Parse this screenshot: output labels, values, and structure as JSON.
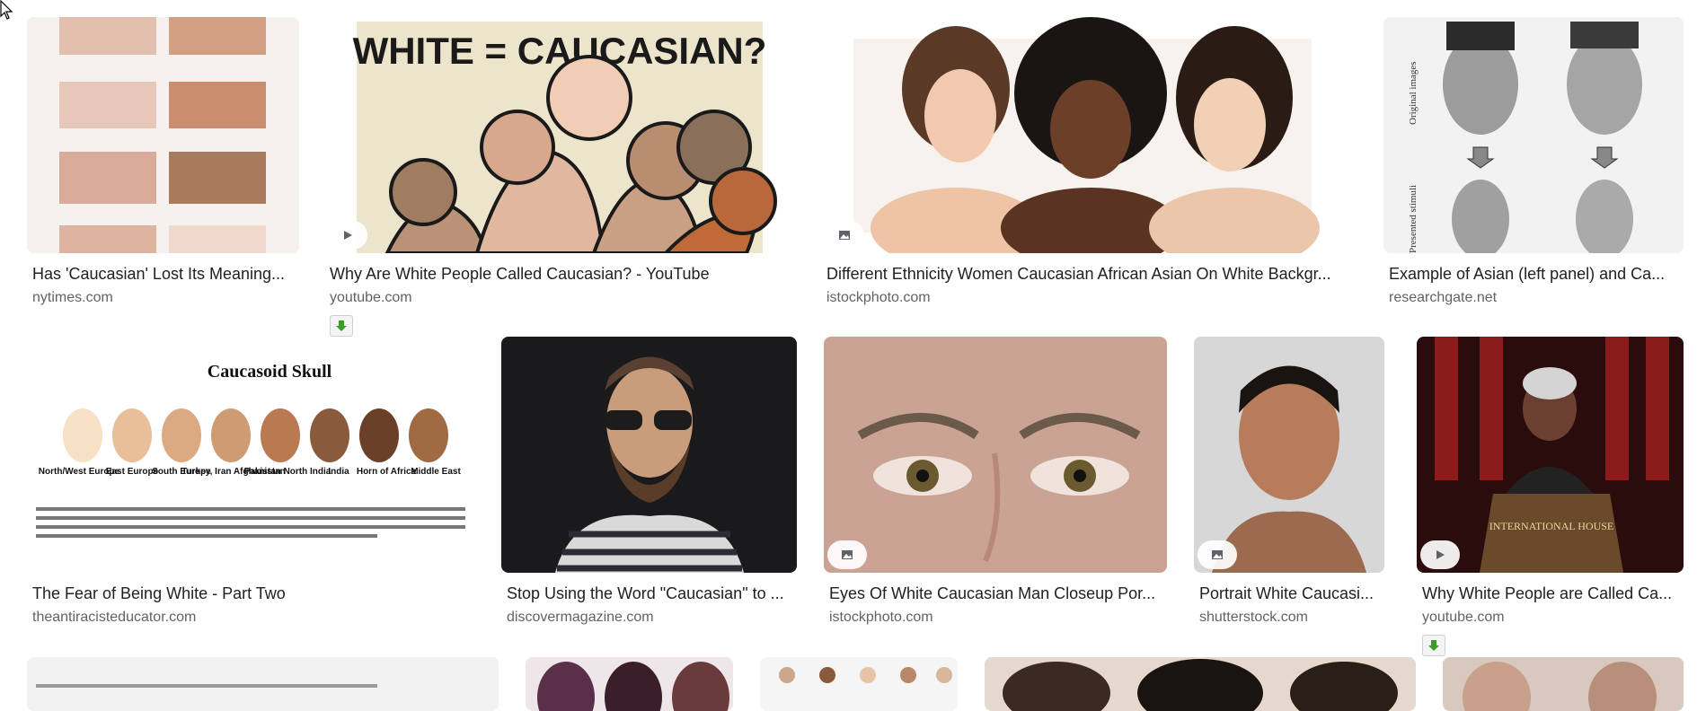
{
  "results": [
    {
      "title": "Has 'Caucasian' Lost Its Meaning...",
      "source": "nytimes.com",
      "badge": "none",
      "download": false
    },
    {
      "title": "Why Are White People Called Caucasian? - YouTube",
      "source": "youtube.com",
      "badge": "video",
      "download": true,
      "thumb_text": "WHITE = CAUCASIAN?"
    },
    {
      "title": "Different Ethnicity Women Caucasian African Asian On White Backgr...",
      "source": "istockphoto.com",
      "badge": "image",
      "download": false
    },
    {
      "title": "Example of Asian (left panel) and Ca...",
      "source": "researchgate.net",
      "badge": "none",
      "download": false,
      "thumb_labels": [
        "Original images",
        "Presented stimuli"
      ]
    },
    {
      "title": "The Fear of Being White - Part Two",
      "source": "theantiracisteducator.com",
      "badge": "none",
      "download": false,
      "thumb_text": "Caucasoid Skull",
      "thumb_labels": [
        "North/West Europe",
        "East Europe",
        "South Europe",
        "Turkey, Iran Afghanistan",
        "Pakistan North India",
        "India",
        "Horn of Africa",
        "Middle East"
      ]
    },
    {
      "title": "Stop Using the Word \"Caucasian\" to ...",
      "source": "discovermagazine.com",
      "badge": "none",
      "download": false
    },
    {
      "title": "Eyes Of White Caucasian Man Closeup Por...",
      "source": "istockphoto.com",
      "badge": "image",
      "download": false
    },
    {
      "title": "Portrait White Caucasi...",
      "source": "shutterstock.com",
      "badge": "image",
      "download": false
    },
    {
      "title": "Why White People are Called Ca...",
      "source": "youtube.com",
      "badge": "video",
      "download": true,
      "thumb_text": "INTERNATIONAL HOUSE"
    }
  ],
  "icons": {
    "video": "play-icon",
    "image": "image-icon",
    "download": "download-arrow-icon",
    "cursor": "mouse-cursor-icon"
  },
  "colors": {
    "title": "#202124",
    "source": "#5f6368",
    "download_green": "#3a9d23"
  }
}
